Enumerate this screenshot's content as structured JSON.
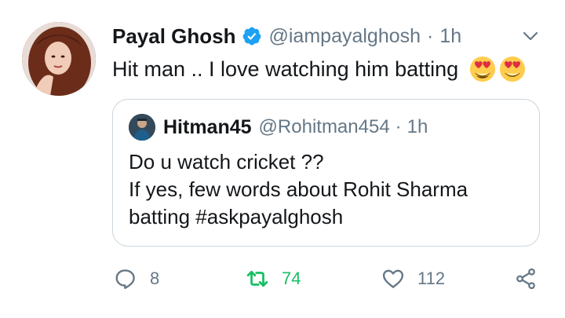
{
  "tweet": {
    "author": {
      "name": "Payal Ghosh",
      "handle": "@iampayalghosh",
      "verified": true,
      "avatar": "profile-photo"
    },
    "time": "1h",
    "separator": "·",
    "text": "Hit man .. I love watching him batting",
    "emojis": [
      "heart-eyes-emoji",
      "heart-eyes-emoji"
    ]
  },
  "quote": {
    "author": {
      "name": "Hitman45",
      "handle": "@Rohitman454",
      "avatar": "profile-photo"
    },
    "time": "1h",
    "separator": "·",
    "lines": [
      "Do u watch cricket ??",
      "If yes, few words about Rohit Sharma",
      "batting #askpayalghosh"
    ]
  },
  "actions": {
    "replies": "8",
    "retweets": "74",
    "likes": "112"
  },
  "colors": {
    "text": "#14171a",
    "secondary": "#657786",
    "verified_blue": "#1da1f2",
    "retweet_green": "#17bf63",
    "border": "#ccd6dd"
  }
}
